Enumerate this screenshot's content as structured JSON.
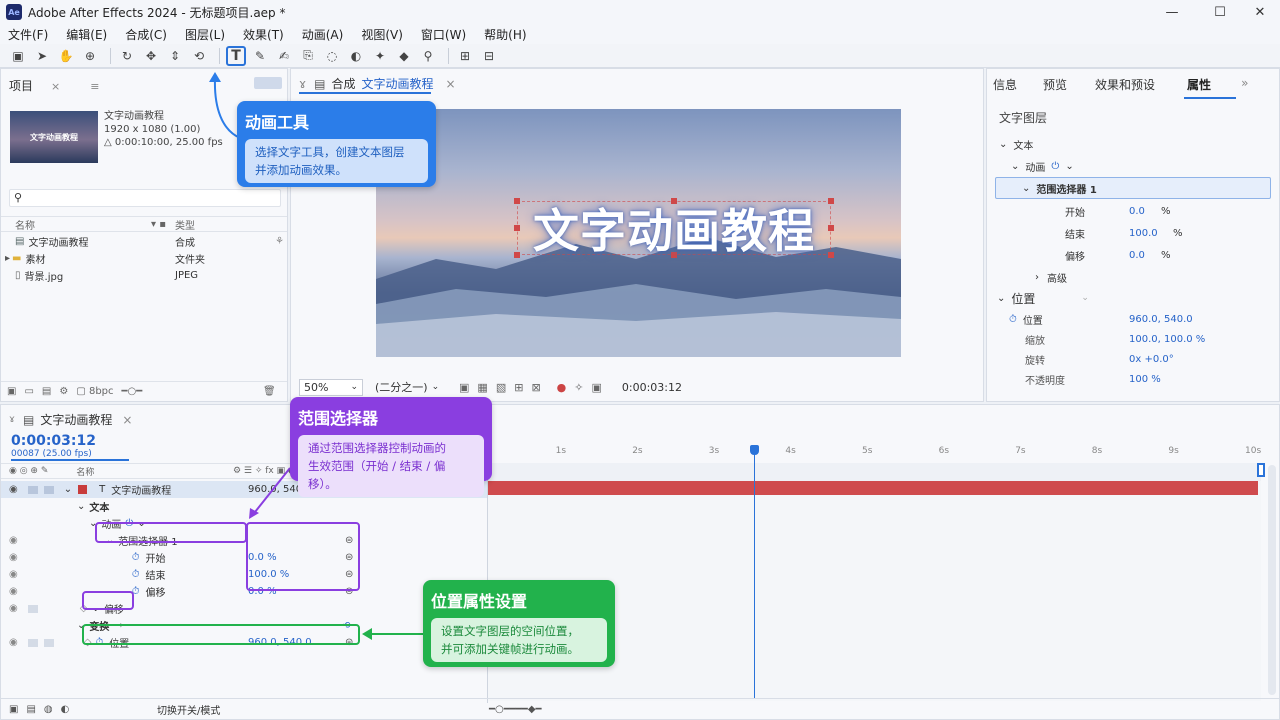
{
  "window": {
    "title": "Adobe After Effects 2024 - 无标题项目.aep *",
    "app_icon": "Ae",
    "minimize": "—",
    "maximize": "☐",
    "close": "✕"
  },
  "menu": [
    "文件(F)",
    "编辑(E)",
    "合成(C)",
    "图层(L)",
    "效果(T)",
    "动画(A)",
    "视图(V)",
    "窗口(W)",
    "帮助(H)"
  ],
  "project": {
    "tab": "项目",
    "thumb_text": "文字动画教程",
    "name": "文字动画教程",
    "dims": "1920 x 1080 (1.00)",
    "duration": "△ 0:00:10:00, 25.00 fps",
    "search_icon": "search-icon",
    "col_name": "名称",
    "col_type": "类型",
    "items": [
      {
        "name": "文字动画教程",
        "type": "合成",
        "icon": "composition-icon"
      },
      {
        "name": "素材",
        "type": "文件夹",
        "icon": "folder-icon"
      },
      {
        "name": "背景.jpg",
        "type": "JPEG",
        "icon": "file-icon"
      }
    ]
  },
  "comp_viewer": {
    "tab_prefix": "合成",
    "tab_name": "文字动画教程",
    "overlay_text": "文字动画教程",
    "zoom": "50%",
    "resolution": "(二分之一)",
    "timecode": "0:00:03:12"
  },
  "properties": {
    "tabs": [
      "信息",
      "预览",
      "效果和预设",
      "属性"
    ],
    "active_tab": "属性",
    "layer_title": "文字图层",
    "text": "文本",
    "animate": "动画",
    "range_selector": "范围选择器 1",
    "start_label": "开始",
    "start_val": "0.0",
    "end_label": "结束",
    "end_val": "100.0",
    "offset_label": "偏移",
    "offset_val": "0.0",
    "pct": "%",
    "advanced": "高级",
    "position_group": "位置",
    "position_label": "位置",
    "position_val": "960.0, 540.0",
    "scale_label": "缩放",
    "scale_val": "100.0, 100.0 %",
    "rotation_label": "旋转",
    "rotation_val": "0x +0.0°",
    "opacity_label": "不透明度",
    "opacity_val": "100 %"
  },
  "timeline": {
    "tab": "文字动画教程",
    "timecode": "0:00:03:12",
    "frames": "00087 (25.00 fps)",
    "col_name": "名称",
    "layer_name": "文字动画教程",
    "layer_val": "960.0, 540.0",
    "text": "文本",
    "animate": "动画",
    "range_selector": "范围选择器 1",
    "start_label": "开始",
    "start_val": "0.0 %",
    "end_label": "结束",
    "end_val": "100.0 %",
    "offset_label": "偏移",
    "offset_val": "0.0 %",
    "advanced": "偏移",
    "transform": "变换",
    "position_label": "位置",
    "position_val": "960.0, 540.0",
    "footer_toggle": "切换开关/模式",
    "ruler": [
      "1s",
      "2s",
      "3s",
      "4s",
      "5s",
      "6s",
      "7s",
      "8s",
      "9s",
      "10s"
    ],
    "playhead_s": 3.48
  },
  "callouts": {
    "anim_tool": {
      "title": "动画工具",
      "body1": "选择文字工具，创建文本图层",
      "body2": "并添加动画效果。",
      "color": "#2b7de9"
    },
    "range": {
      "title": "范围选择器",
      "body1": "通过范围选择器控制动画的",
      "body2": "生效范围（开始 / 结束 / 偏移）。",
      "color": "#8a3ee0"
    },
    "position": {
      "title": "位置属性设置",
      "body1": "设置文字图层的空间位置，",
      "body2": "并可添加关键帧进行动画。",
      "color": "#22b24c"
    }
  }
}
